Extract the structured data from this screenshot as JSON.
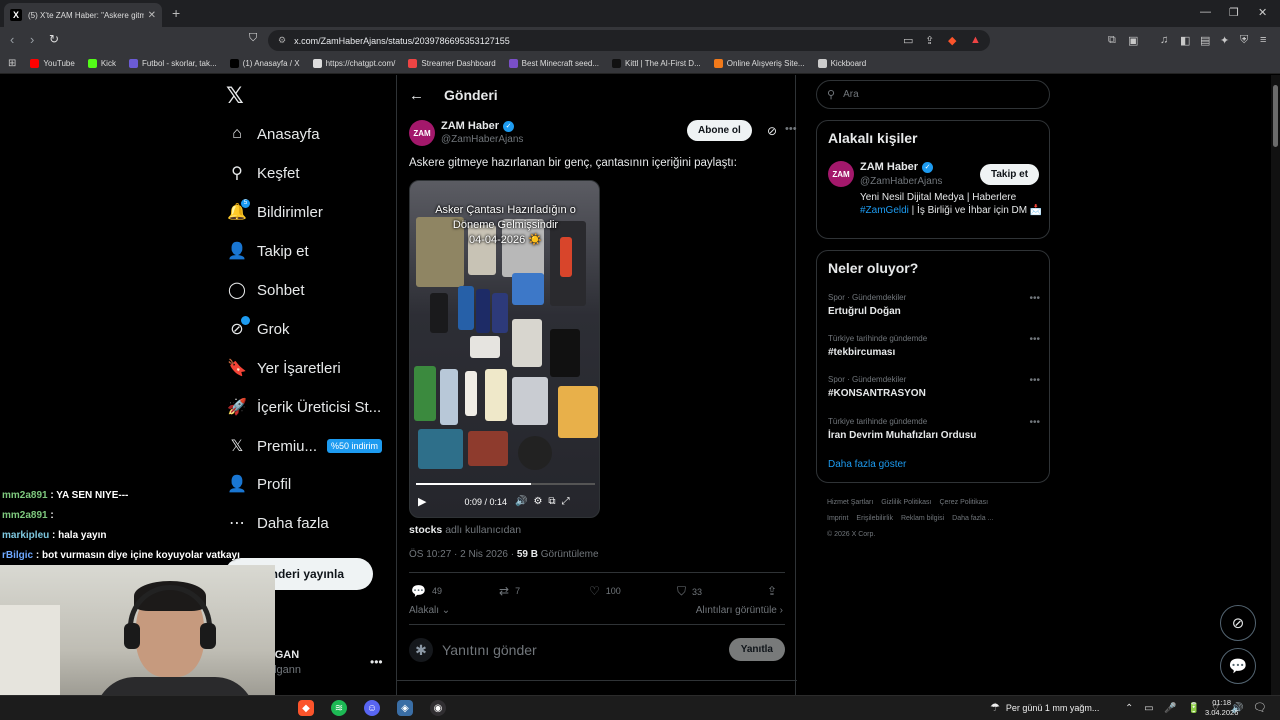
{
  "browser": {
    "tab_title": "(5) X'te ZAM Haber: \"Askere gitm",
    "url": "x.com/ZamHaberAjans/status/2039786695353127155",
    "bookmarks": [
      {
        "label": "YouTube",
        "color": "#ff0000"
      },
      {
        "label": "Kick",
        "color": "#53fc18"
      },
      {
        "label": "Futbol - skorlar, tak...",
        "color": "#6b5bd6"
      },
      {
        "label": "(1) Anasayfa / X",
        "color": "#000000"
      },
      {
        "label": "https://chatgpt.com/",
        "color": "#dddddd"
      },
      {
        "label": "Streamer Dashboard",
        "color": "#e44"
      },
      {
        "label": "Best Minecraft seed...",
        "color": "#7a4fc8"
      },
      {
        "label": "Kittl | The AI-First D...",
        "color": "#111111"
      },
      {
        "label": "Online Alışveriş Site...",
        "color": "#f27a1a"
      },
      {
        "label": "Kickboard",
        "color": "#cccccc"
      }
    ]
  },
  "nav": {
    "items": [
      {
        "label": "Anasayfa",
        "icon": "home-icon",
        "glyph": "⌂"
      },
      {
        "label": "Keşfet",
        "icon": "search-icon",
        "glyph": "⚲"
      },
      {
        "label": "Bildirimler",
        "icon": "bell-icon",
        "glyph": "🔔"
      },
      {
        "label": "Takip et",
        "icon": "follow-icon",
        "glyph": "👤"
      },
      {
        "label": "Sohbet",
        "icon": "chat-icon",
        "glyph": "◯"
      },
      {
        "label": "Grok",
        "icon": "grok-icon",
        "glyph": "⊘"
      },
      {
        "label": "Yer İşaretleri",
        "icon": "bookmark-icon",
        "glyph": "🔖"
      },
      {
        "label": "İçerik Üreticisi St...",
        "icon": "rocket-icon",
        "glyph": "🚀"
      },
      {
        "label": "Premiu...",
        "icon": "x-premium-icon",
        "glyph": "𝕏"
      },
      {
        "label": "Profil",
        "icon": "profile-icon",
        "glyph": "👤"
      },
      {
        "label": "Daha fazla",
        "icon": "more-icon",
        "glyph": "⋯"
      }
    ],
    "notif_badge": "5",
    "premium_promo": "%50 indirim",
    "post_button": "Gönderi yayınla",
    "account_name": "LGAN",
    "account_handle": "algann"
  },
  "post": {
    "header_title": "Gönderi",
    "author_name": "ZAM Haber",
    "author_handle": "@ZamHaberAjans",
    "avatar_text": "ZAM",
    "subscribe_label": "Abone ol",
    "text": "Askere gitmeye hazırlanan bir genç, çantasının içeriğini paylaştı:",
    "video_caption": "Asker Çantası Hazırladığın o\nDöneme Gelmişsindir\n04-04-2026 ☀️",
    "video_time": "0:09 / 0:14",
    "video_progress": 0.64,
    "source_user": "stocks",
    "source_suffix": " adlı kullanıcıdan",
    "timestamp": "ÖS 10:27 · 2 Nis 2026 · ",
    "views": "59 B",
    "views_label": " Görüntüleme",
    "replies": "49",
    "reposts": "7",
    "likes": "100",
    "bookmarks": "33",
    "related_label": "Alakalı",
    "quotes_label": "Alıntıları görüntüle",
    "reply_placeholder": "Yanıtını gönder",
    "reply_button": "Yanıtla"
  },
  "sidebar": {
    "search_placeholder": "Ara",
    "related_title": "Alakalı kişiler",
    "rp_name": "ZAM Haber",
    "rp_handle": "@ZamHaberAjans",
    "rp_follow": "Takip et",
    "rp_bio_1": "Yeni Nesil Dijital Medya | Haberlere",
    "rp_bio_tag": "#ZamGeldi",
    "rp_bio_2": " | İş Birliği ve İhbar için DM 📩",
    "trends_title": "Neler oluyor?",
    "trends": [
      {
        "category": "Spor · Gündemdekiler",
        "name": "Ertuğrul Doğan"
      },
      {
        "category": "Türkiye tarihinde gündemde",
        "name": "#tekbircuması"
      },
      {
        "category": "Spor · Gündemdekiler",
        "name": "#KONSANTRASYON"
      },
      {
        "category": "Türkiye tarihinde gündemde",
        "name": "İran Devrim Muhafızları Ordusu"
      }
    ],
    "show_more": "Daha fazla göster",
    "footer": [
      "Hizmet Şartları",
      "Gizlilik Politikası",
      "Çerez Politikası",
      "Imprint",
      "Erişilebilirlik",
      "Reklam bilgisi",
      "Daha fazla ...",
      "© 2026 X Corp."
    ]
  },
  "chat": [
    {
      "user": "mm2a891",
      "msg": " : YA SEN NIYE---"
    },
    {
      "user": "mm2a891",
      "msg": " : "
    },
    {
      "user": "markipleu",
      "msg": " : hala yayın"
    },
    {
      "user": "rBilgic",
      "msg": " : bot vurmasın diye içine koyuyolar vatkayı"
    }
  ],
  "taskbar": {
    "weather": "Per günü 1 mm yağm...",
    "time": "01:18",
    "date": "3.04.2026"
  }
}
